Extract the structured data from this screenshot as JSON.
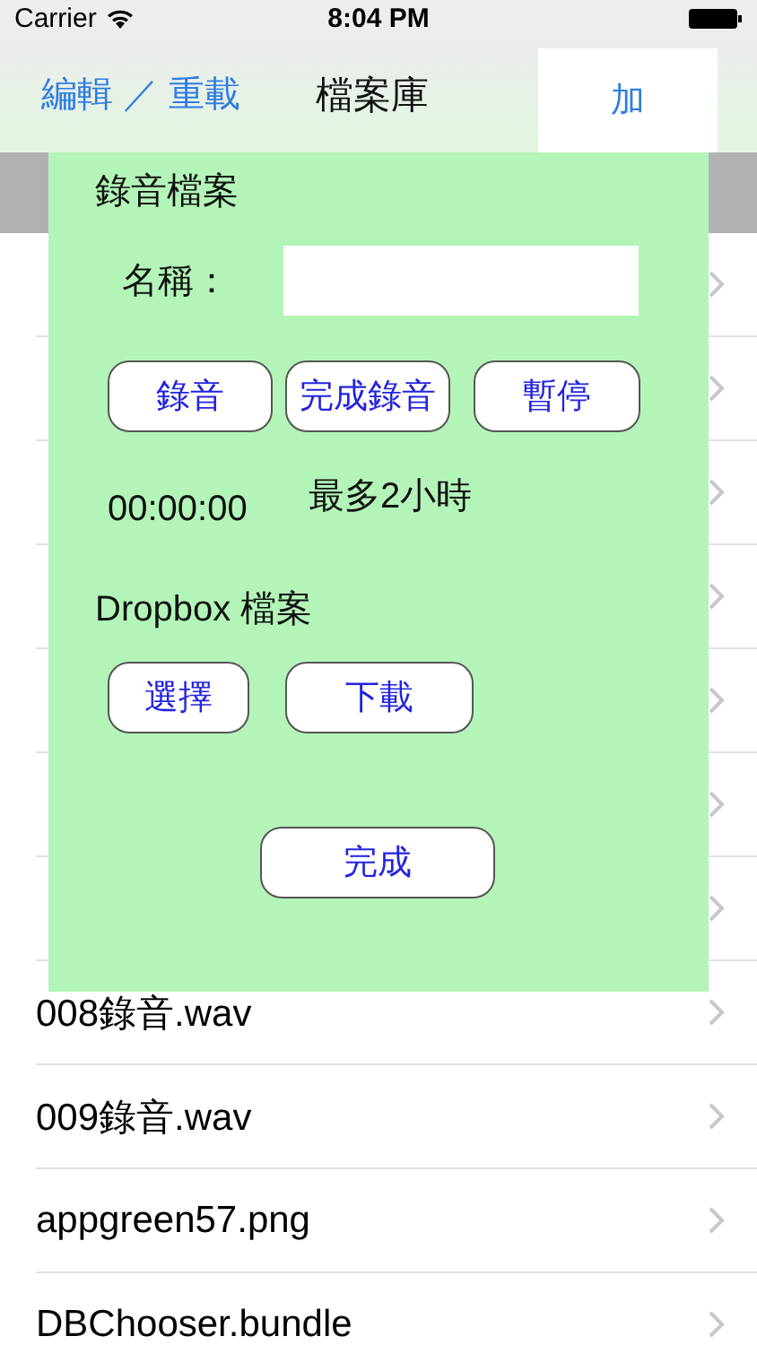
{
  "status_bar": {
    "carrier": "Carrier",
    "time": "8:04 PM"
  },
  "nav_bar": {
    "left_button": "編輯 ／ 重載",
    "title": "檔案庫",
    "right_button": "加"
  },
  "files": [
    {
      "kind": "covered"
    },
    {
      "kind": "covered"
    },
    {
      "kind": "covered"
    },
    {
      "kind": "covered"
    },
    {
      "kind": "covered"
    },
    {
      "kind": "covered"
    },
    {
      "kind": "covered"
    },
    {
      "kind": "file",
      "name": "008錄音.wav"
    },
    {
      "kind": "file",
      "name": "009錄音.wav"
    },
    {
      "kind": "file",
      "name": "appgreen57.png"
    },
    {
      "kind": "file",
      "name": "DBChooser.bundle"
    }
  ],
  "record_panel": {
    "title": "錄音檔案",
    "name_label": "名稱：",
    "record_buttons": [
      "錄音",
      "完成錄音",
      "暫停"
    ],
    "timer": "00:00:00",
    "limit_note": "最多2小時",
    "dropbox_title": "Dropbox 檔案",
    "dropbox_buttons": [
      "選擇",
      "下載"
    ],
    "done_button": "完成"
  }
}
